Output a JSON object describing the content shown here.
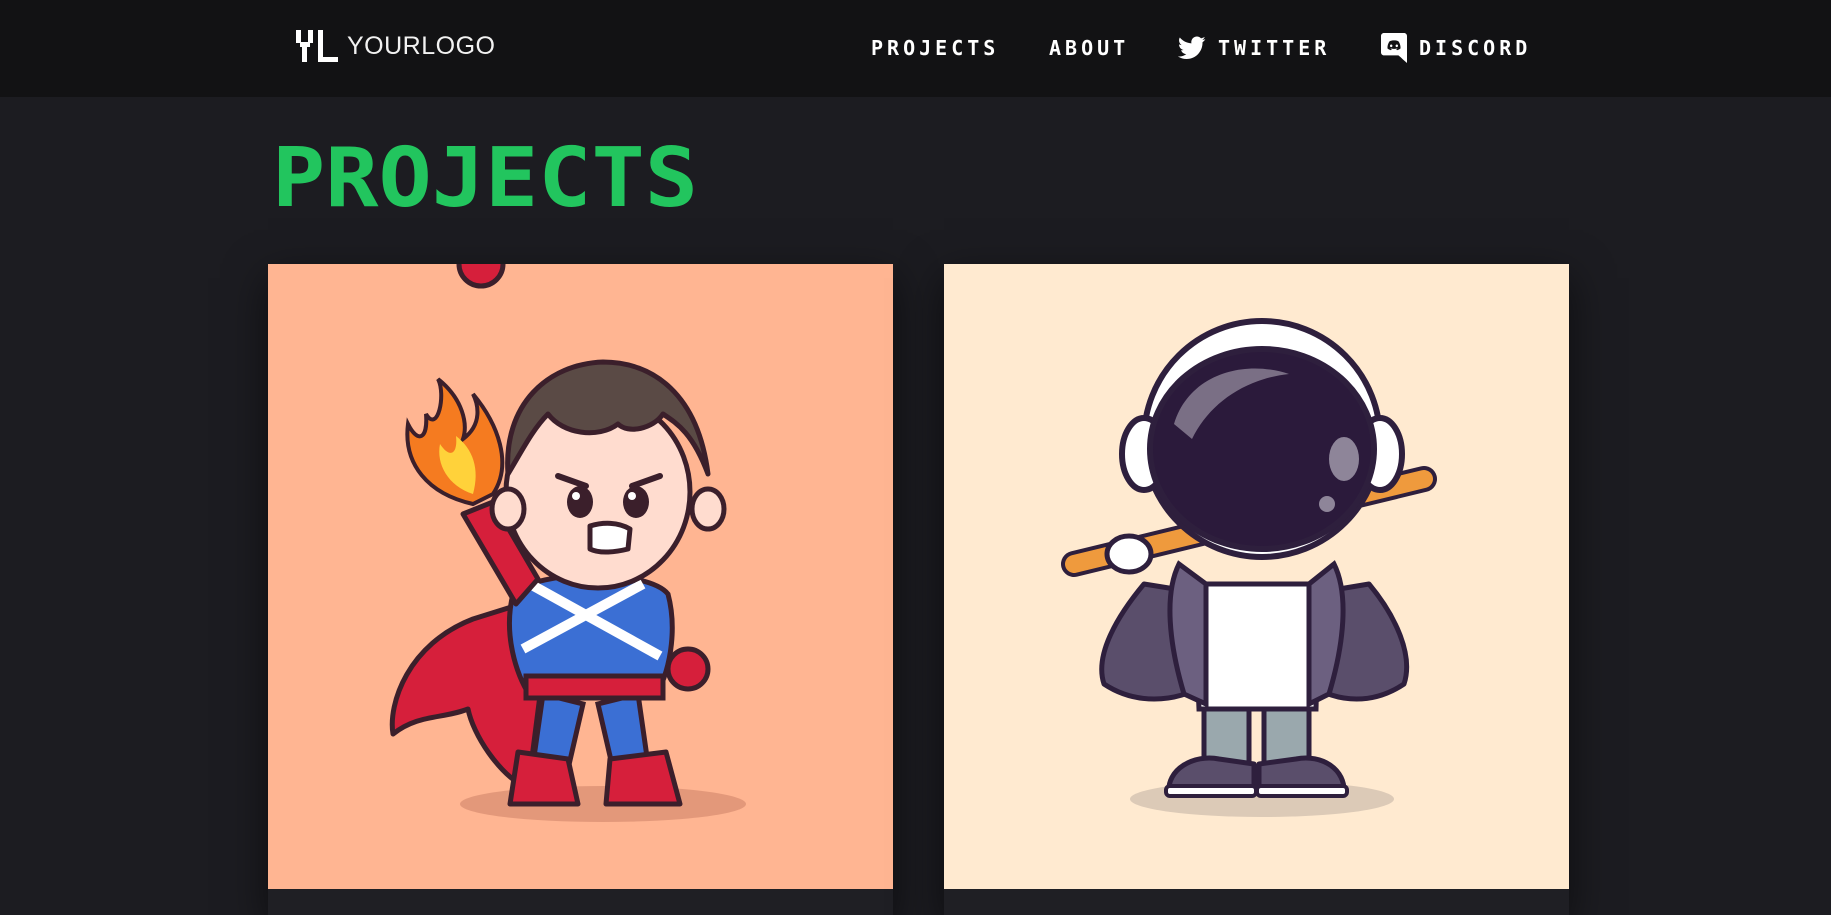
{
  "header": {
    "logo_text": "YOURLOGO",
    "nav": [
      {
        "label": "PROJECTS",
        "icon": null
      },
      {
        "label": "ABOUT",
        "icon": null
      },
      {
        "label": "TWITTER",
        "icon": "twitter-icon"
      },
      {
        "label": "DISCORD",
        "icon": "discord-icon"
      }
    ]
  },
  "main": {
    "title": "PROJECTS",
    "projects": [
      {
        "image": "superhero-character-illustration",
        "background": "#ffb592"
      },
      {
        "image": "astronaut-with-baseball-bat-illustration",
        "background": "#ffead0"
      }
    ]
  },
  "colors": {
    "header_bg": "#121214",
    "page_bg": "#1c1c21",
    "accent": "#22c55e",
    "text": "#ffffff"
  }
}
